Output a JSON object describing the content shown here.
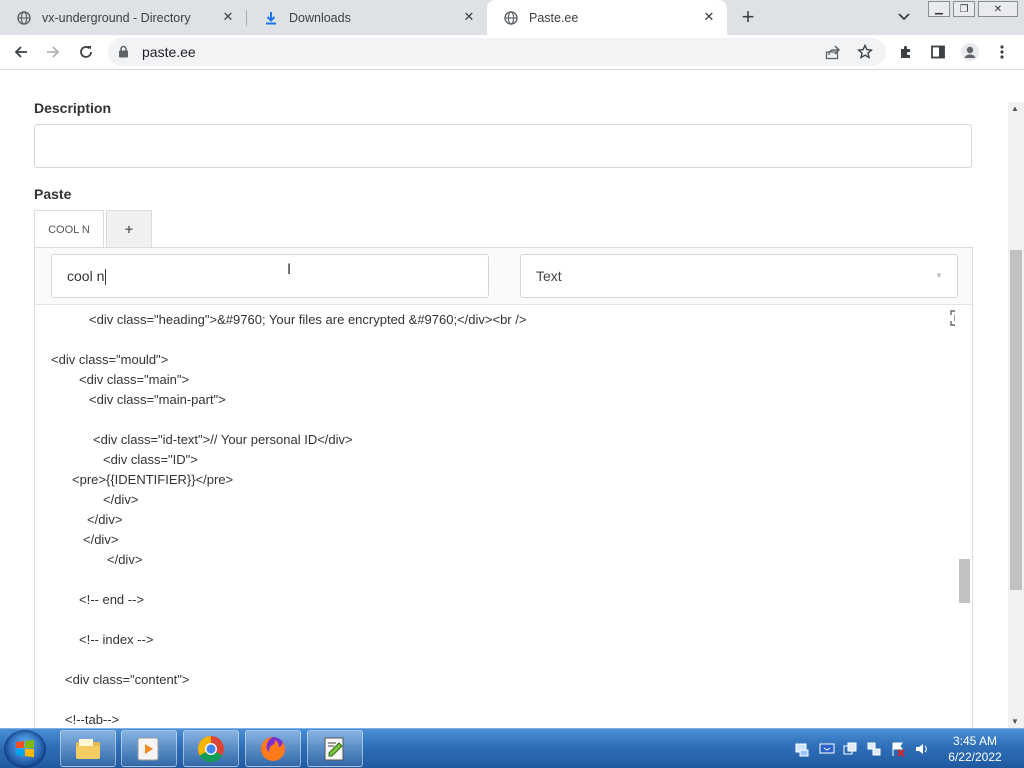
{
  "browser": {
    "tabs": [
      {
        "label": "vx-underground - Directory",
        "icon": "globe-icon"
      },
      {
        "label": "Downloads",
        "icon": "download-icon"
      },
      {
        "label": "Paste.ee",
        "icon": "globe-icon",
        "active": true
      }
    ],
    "url": "paste.ee"
  },
  "form": {
    "description_label": "Description",
    "description_value": "",
    "paste_label": "Paste",
    "paste_tabs": [
      {
        "label": "COOL N",
        "active": true
      },
      {
        "label": "+"
      }
    ],
    "paste_name_value": "cool n",
    "syntax_value": "Text"
  },
  "editor": {
    "lines": [
      "<div class=\"heading\">&#9760; Your files are encrypted &#9760;</div><br />",
      "",
      "<div class=\"mould\">",
      "<div class=\"main\">",
      "<div class=\"main-part\">",
      "",
      "<div class=\"id-text\">// Your personal ID</div>",
      "<div class=\"ID\">",
      "<pre>{{IDENTIFIER}}</pre>",
      "</div>",
      "</div>",
      "</div>",
      "</div>",
      "",
      "<!-- end -->",
      "",
      "<!-- index -->",
      "",
      "<div class=\"content\">",
      "",
      "<!--tab-->"
    ]
  },
  "taskbar": {
    "apps": [
      "file-explorer-icon",
      "media-player-icon",
      "chrome-icon",
      "firefox-icon",
      "notepad-plus-icon"
    ],
    "time": "3:45 AM",
    "date": "6/22/2022"
  }
}
